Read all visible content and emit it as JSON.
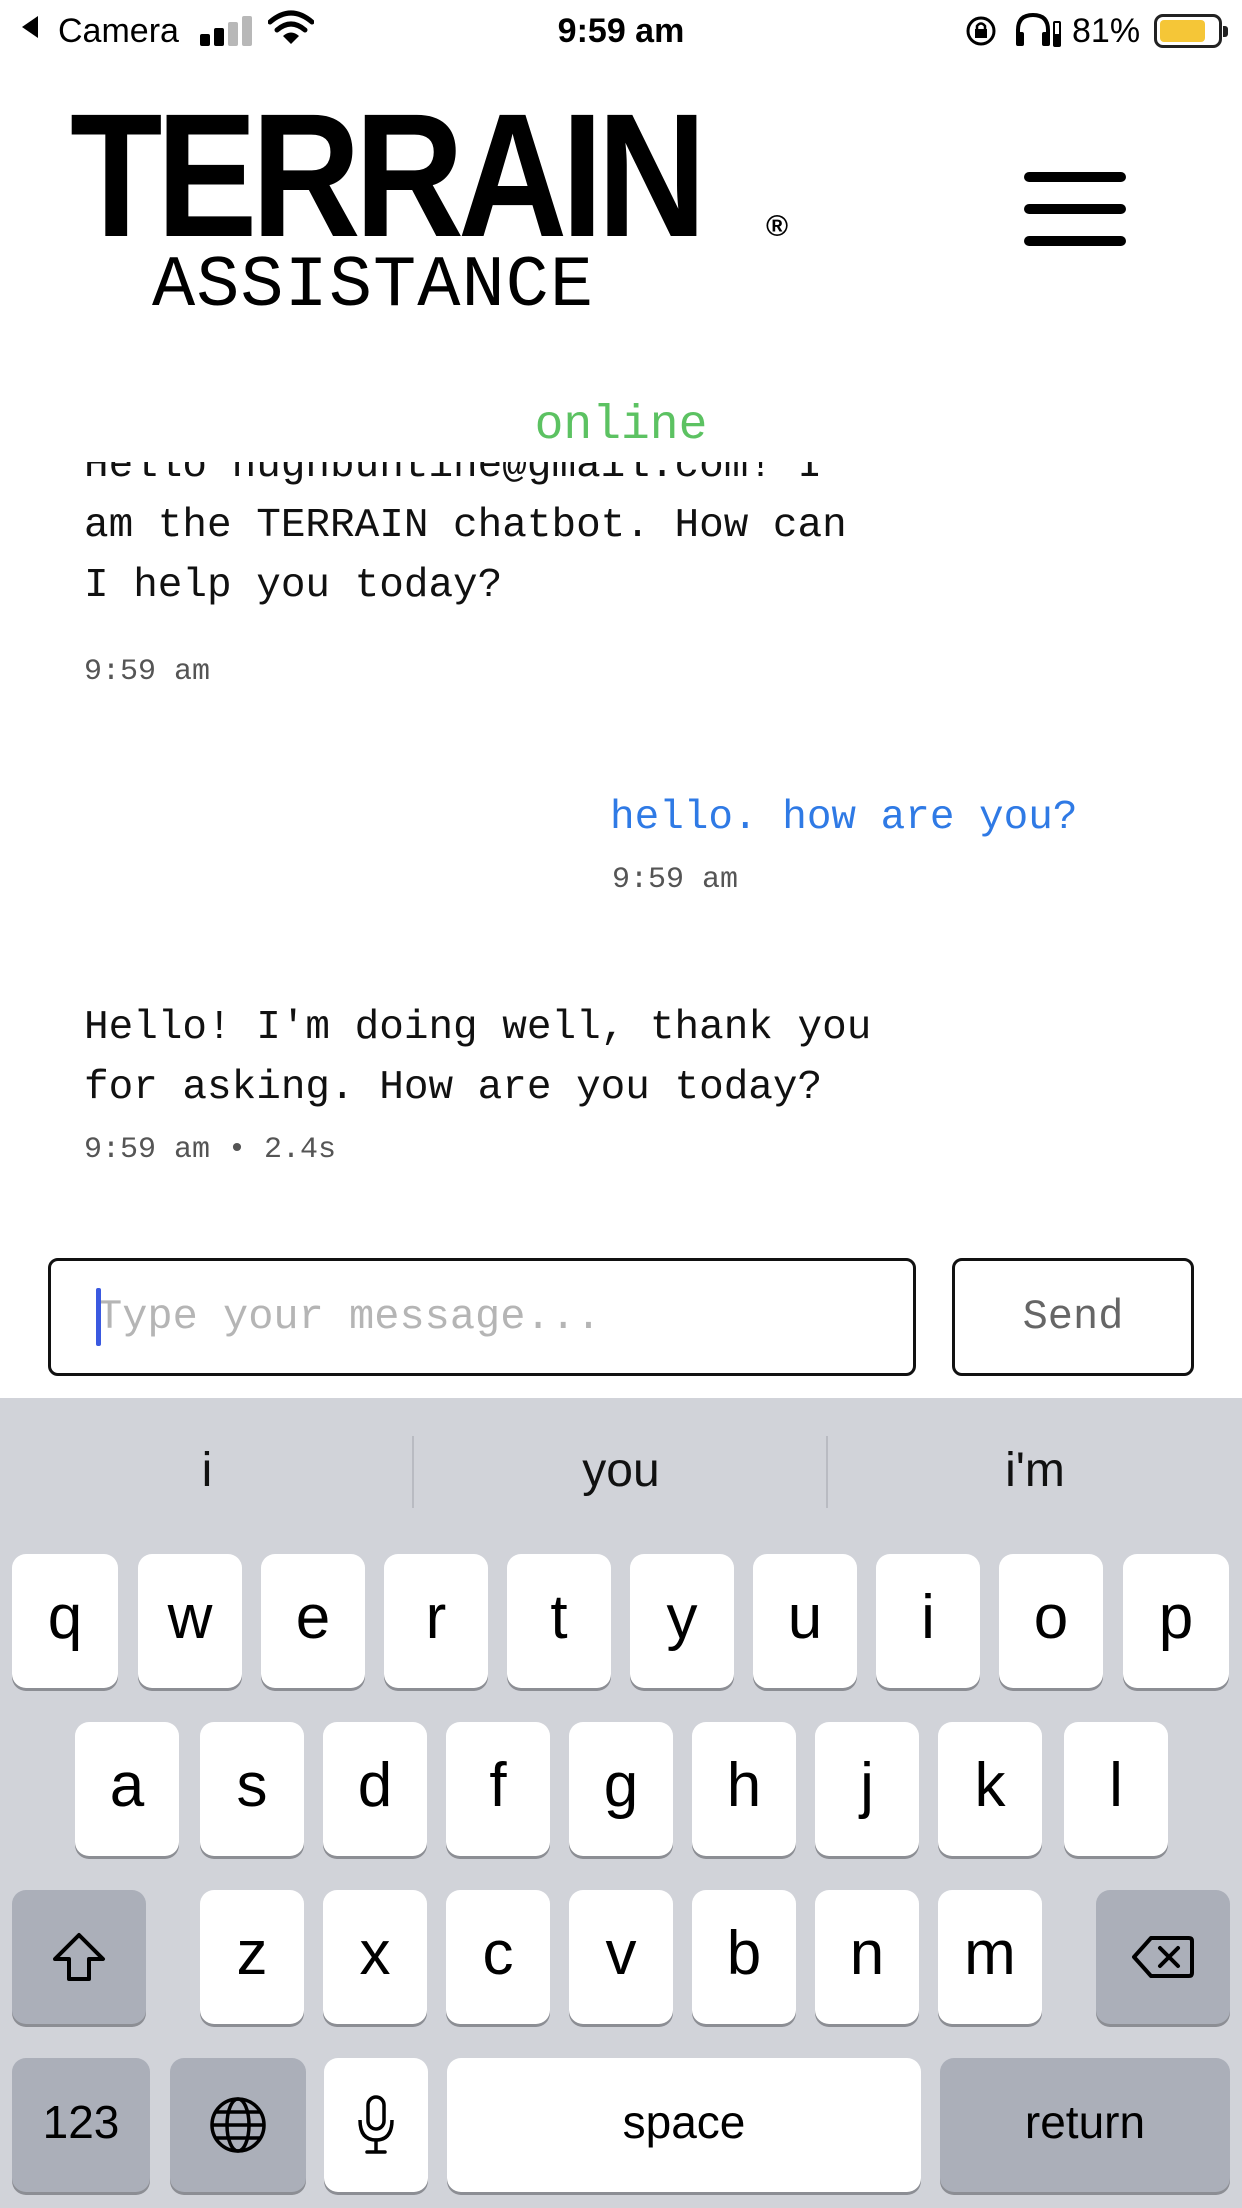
{
  "status_bar": {
    "back_app": "Camera",
    "time": "9:59 am",
    "battery_percent": "81%",
    "battery_level": 0.81,
    "icons": [
      "back-arrow-icon",
      "signal-icon",
      "wifi-icon",
      "orientation-lock-icon",
      "headphones-icon",
      "battery-icon"
    ]
  },
  "header": {
    "logo_main": "TERRAIN",
    "logo_registered": "®",
    "logo_sub": "ASSISTANCE",
    "menu_icon": "hamburger-menu-icon"
  },
  "chat": {
    "status": "online",
    "messages": [
      {
        "from": "bot",
        "text": "Hello hughbuntine@gmail.com! I\nam the TERRAIN chatbot. How can\nI help you today?",
        "meta": "9:59 am"
      },
      {
        "from": "user",
        "text": "hello. how are you?",
        "meta": "9:59 am"
      },
      {
        "from": "bot",
        "text": "Hello! I'm doing well, thank you\nfor asking. How are you today?",
        "meta": "9:59 am • 2.4s"
      }
    ]
  },
  "composer": {
    "placeholder": "Type your message...",
    "value": "",
    "send_label": "Send"
  },
  "keyboard": {
    "suggestions": [
      "i",
      "you",
      "i'm"
    ],
    "row1": [
      "q",
      "w",
      "e",
      "r",
      "t",
      "y",
      "u",
      "i",
      "o",
      "p"
    ],
    "row2": [
      "a",
      "s",
      "d",
      "f",
      "g",
      "h",
      "j",
      "k",
      "l"
    ],
    "row3": [
      "z",
      "x",
      "c",
      "v",
      "b",
      "n",
      "m"
    ],
    "numbers_label": "123",
    "space_label": "space",
    "return_label": "return",
    "icons": [
      "shift-icon",
      "backspace-icon",
      "globe-icon",
      "microphone-icon"
    ]
  },
  "colors": {
    "online": "#5cc262",
    "user_message": "#2f7ae5",
    "keyboard_bg": "#d1d3d9",
    "battery": "#f5c637"
  }
}
